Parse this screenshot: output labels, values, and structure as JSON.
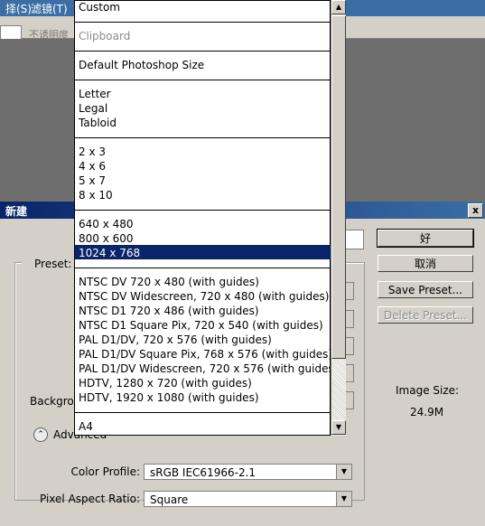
{
  "app_menu": {
    "select_partial": "择(S)",
    "filter": "滤镜(T)"
  },
  "options_bar": {
    "opacity_label": "不诱明度"
  },
  "dialog": {
    "title": "新建",
    "close_glyph": "x",
    "preset_label": "Preset:",
    "background_label_partial": "Backgrou",
    "image_size_label": "Image Size:",
    "image_size_value": "24.9M",
    "advanced_label": "Advanced",
    "advanced_icon": "chevron-up-icon",
    "color_profile_label": "Color Profile:",
    "color_profile_value": "sRGB IEC61966-2.1",
    "pixel_aspect_label": "Pixel Aspect Ratio:",
    "pixel_aspect_value": "Square",
    "buttons": {
      "ok": "好",
      "cancel": "取消",
      "save_preset": "Save Preset...",
      "delete_preset": "Delete Preset..."
    }
  },
  "preset_dropdown": {
    "groups": [
      [
        "Custom"
      ],
      [
        "Clipboard"
      ],
      [
        "Default Photoshop Size"
      ],
      [
        "Letter",
        "Legal",
        "Tabloid"
      ],
      [
        "2 x 3",
        "4 x 6",
        "5 x 7",
        "8 x 10"
      ],
      [
        "640 x 480",
        "800 x 600",
        "1024 x 768"
      ],
      [
        "NTSC DV 720 x 480 (with guides)",
        "NTSC DV Widescreen, 720 x 480 (with guides)",
        "NTSC D1 720 x 486 (with guides)",
        "NTSC D1 Square Pix, 720 x 540 (with guides)",
        "PAL D1/DV, 720 x 576 (with guides)",
        "PAL D1/DV Square Pix, 768 x 576 (with guides)",
        "PAL D1/DV Widescreen, 720 x 576 (with guides)",
        "HDTV, 1280 x 720 (with guides)",
        "HDTV, 1920 x 1080 (with guides)"
      ],
      [
        "A4"
      ]
    ],
    "selected": "1024 x 768",
    "disabled": [
      "Clipboard"
    ]
  },
  "colors": {
    "selection": "#0a246a",
    "dialog_face": "#d4d0c8",
    "title_bar": "#0a246a"
  }
}
